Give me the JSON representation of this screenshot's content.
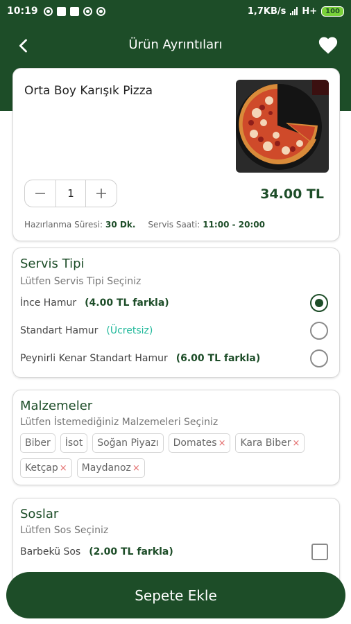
{
  "status_bar": {
    "time": "10:19",
    "speed": "1,7KB/s",
    "network": "H+",
    "battery": "100"
  },
  "header": {
    "title": "Ürün Ayrıntıları"
  },
  "product": {
    "name": "Orta Boy Karışık Pizza",
    "quantity": "1",
    "price": "34.00 TL",
    "prep_label": "Hazırlanma Süresi:",
    "prep_value": "30 Dk.",
    "service_label": "Servis Saati:",
    "service_value": "11:00 - 20:00"
  },
  "servis_tipi": {
    "title": "Servis Tipi",
    "subtitle": "Lütfen Servis Tipi Seçiniz",
    "options": [
      {
        "label": "İnce Hamur",
        "extra": "(4.00 TL farkla)",
        "selected": true
      },
      {
        "label": "Standart Hamur",
        "extra": "(Ücretsiz)",
        "selected": false
      },
      {
        "label": "Peynirli Kenar Standart Hamur",
        "extra": "(6.00 TL farkla)",
        "selected": false
      }
    ]
  },
  "malzemeler": {
    "title": "Malzemeler",
    "subtitle": "Lütfen İstemediğiniz Malzemeleri Seçiniz",
    "chips": [
      "Biber",
      "İsot",
      "Soğan Piyazı",
      "Domates",
      "Kara Biber",
      "Ketçap",
      "Maydanoz"
    ],
    "remove_glyph": "×"
  },
  "soslar": {
    "title": "Soslar",
    "subtitle": "Lütfen Sos Seçiniz",
    "options": [
      {
        "label": "Barbekü Sos",
        "extra": "(2.00 TL farkla)",
        "checked": false
      }
    ]
  },
  "add_button": {
    "label": "Sepete Ekle"
  },
  "colors": {
    "primary": "#1d4d28",
    "free": "#1fb89a",
    "remove": "#e36b6b"
  }
}
